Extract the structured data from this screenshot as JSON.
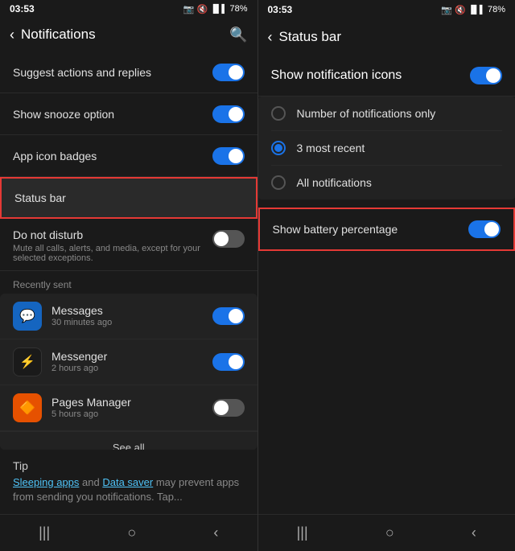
{
  "left": {
    "statusBar": {
      "time": "03:53",
      "timeIcon": "📷",
      "signalIcon": "🔇",
      "networkIcon": "📶",
      "batteryIcon": "78%"
    },
    "title": "Notifications",
    "searchIcon": "🔍",
    "items": [
      {
        "id": "suggest",
        "label": "Suggest actions and replies",
        "toggle": "on"
      },
      {
        "id": "snooze",
        "label": "Show snooze option",
        "toggle": "on"
      },
      {
        "id": "badges",
        "label": "App icon badges",
        "toggle": "on"
      },
      {
        "id": "statusbar",
        "label": "Status bar",
        "toggle": null,
        "highlighted": true
      }
    ],
    "doNotDisturb": {
      "label": "Do not disturb",
      "sub": "Mute all calls, alerts, and media, except for your selected exceptions.",
      "toggle": "off"
    },
    "recentlySentLabel": "Recently sent",
    "apps": [
      {
        "id": "messages",
        "name": "Messages",
        "time": "30 minutes ago",
        "toggle": "on",
        "icon": "messages",
        "emoji": "💬"
      },
      {
        "id": "messenger",
        "name": "Messenger",
        "time": "2 hours ago",
        "toggle": "on",
        "icon": "messenger",
        "emoji": "🔵"
      },
      {
        "id": "pages",
        "name": "Pages Manager",
        "time": "5 hours ago",
        "toggle": "off",
        "icon": "pages",
        "emoji": "🔶"
      }
    ],
    "seeAll": "See all",
    "tip": {
      "title": "Tip",
      "linkText1": "Sleeping apps",
      "midText": " and ",
      "linkText2": "Data saver",
      "endText": " may prevent apps from sending you notifications. Tap..."
    },
    "navIcons": [
      "|||",
      "○",
      "<"
    ]
  },
  "right": {
    "statusBar": {
      "time": "03:53",
      "timeIcon": "📷",
      "signalIcon": "🔇",
      "networkIcon": "📶",
      "batteryIcon": "78%"
    },
    "title": "Status bar",
    "showNotifLabel": "Show notification icons",
    "showNotifToggle": "on",
    "radioOptions": [
      {
        "id": "number-only",
        "label": "Number of notifications only",
        "selected": false
      },
      {
        "id": "3-recent",
        "label": "3 most recent",
        "selected": true
      },
      {
        "id": "all",
        "label": "All notifications",
        "selected": false
      }
    ],
    "batteryItem": {
      "label": "Show battery percentage",
      "toggle": "on",
      "highlighted": true
    },
    "navIcons": [
      "|||",
      "○",
      "<"
    ]
  }
}
